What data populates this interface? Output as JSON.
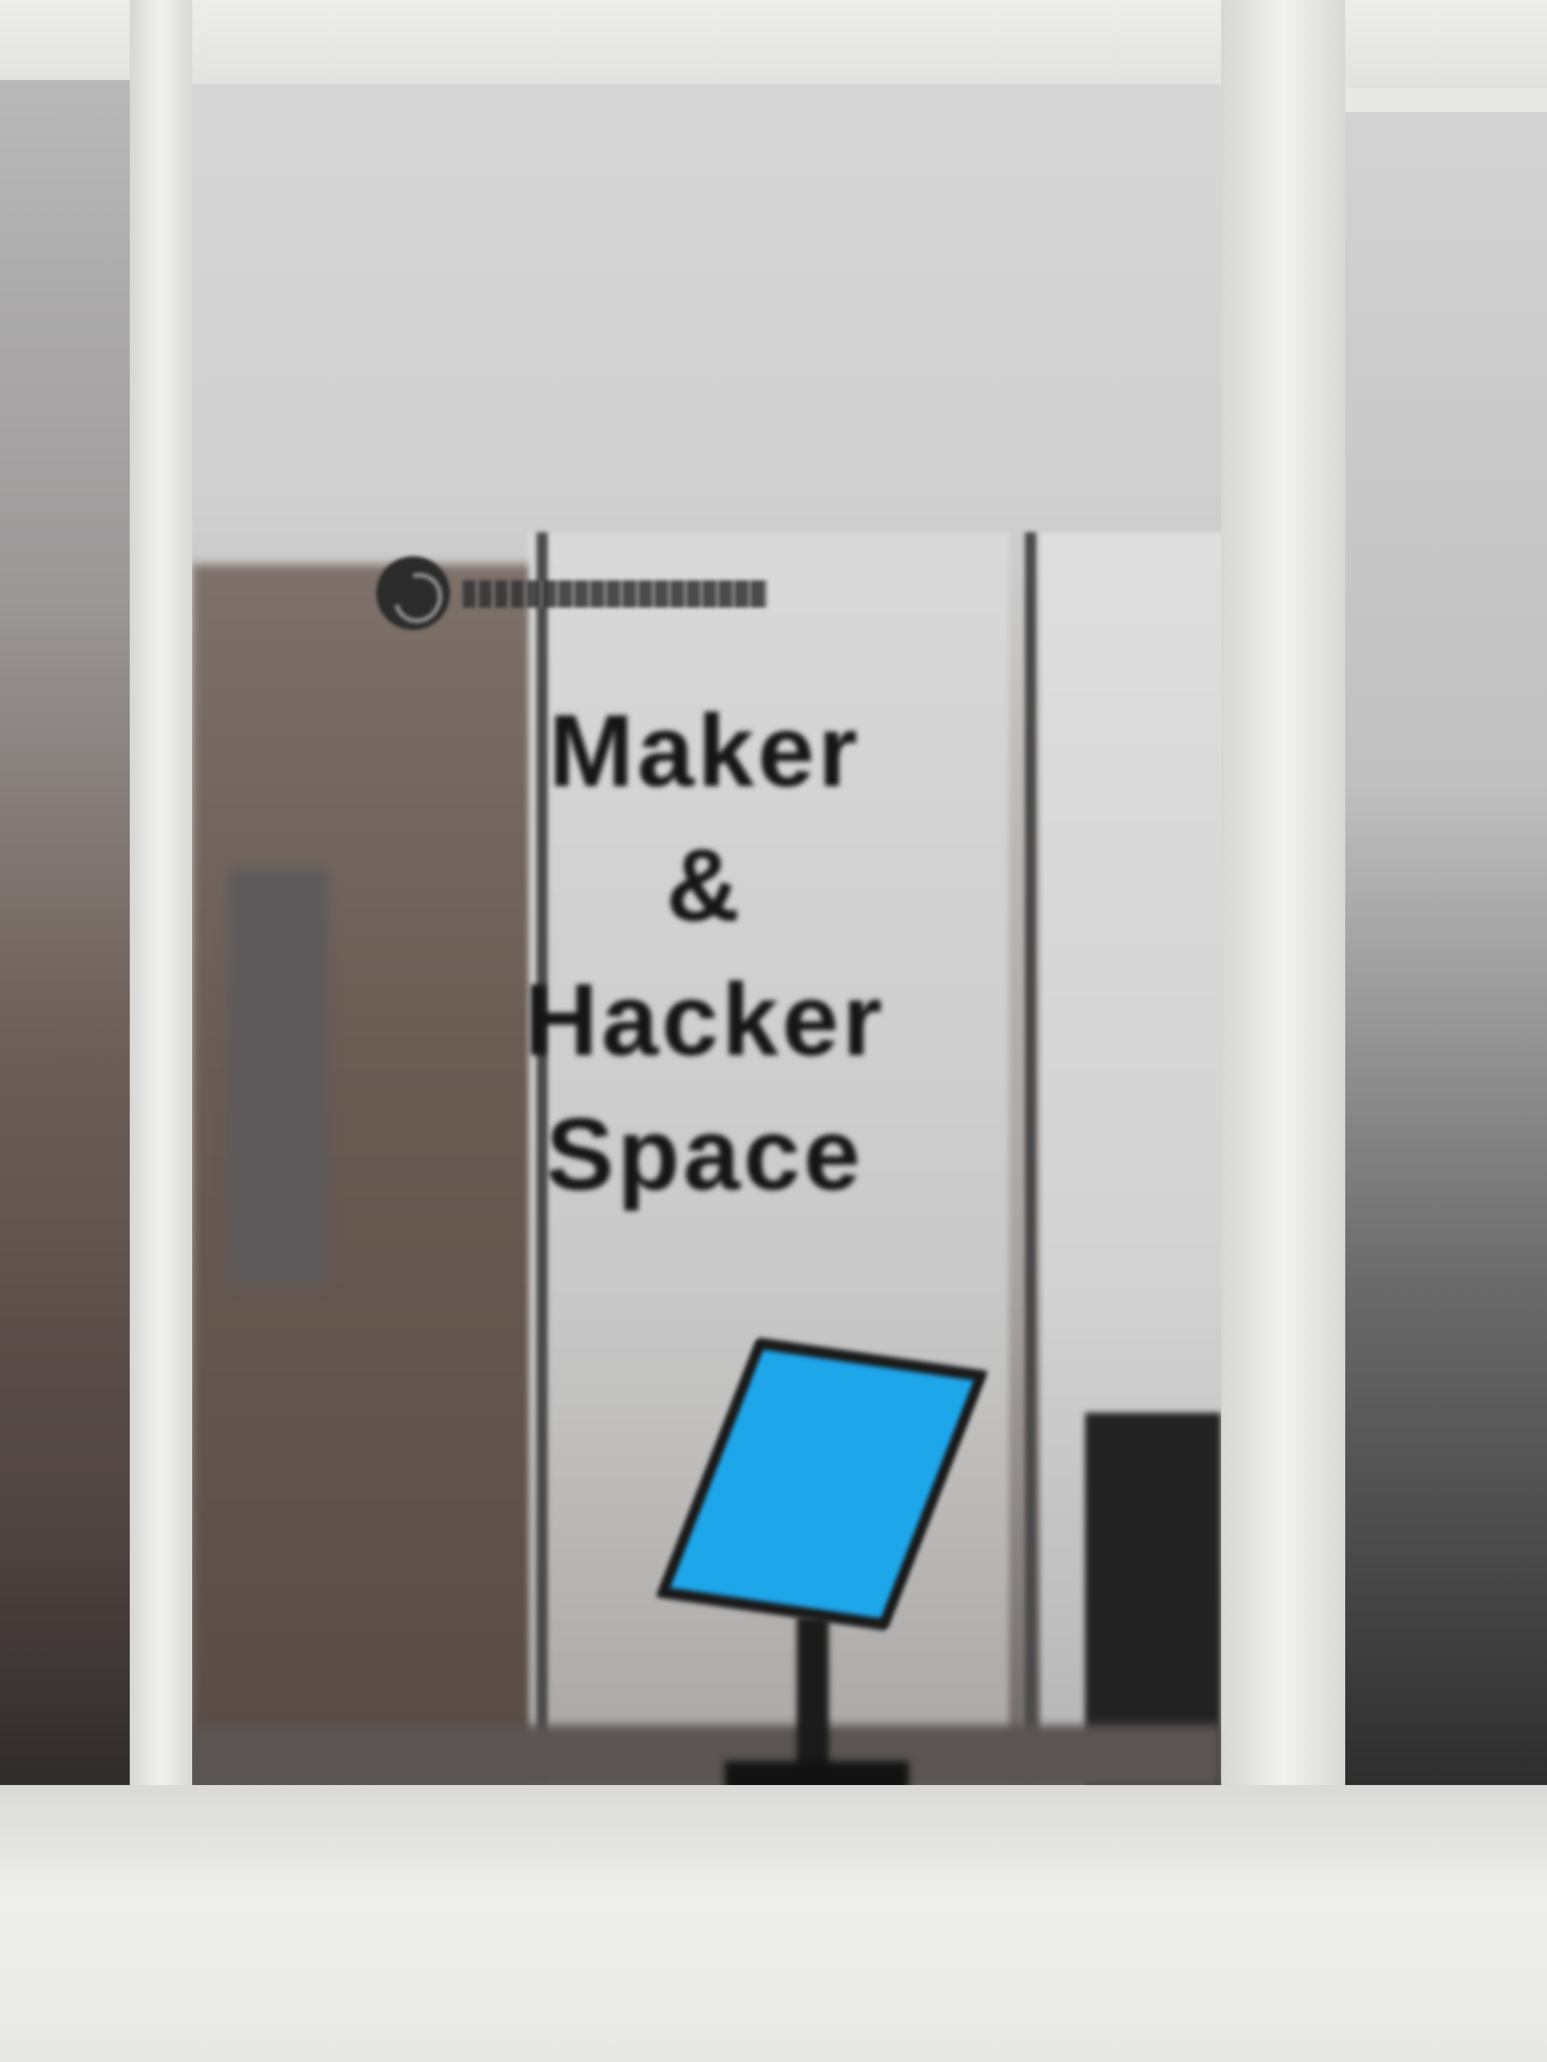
{
  "scene": {
    "sign_lines": [
      "Maker",
      "&",
      "Hacker",
      "Space"
    ],
    "screen_color": "#1ea6ea",
    "icons": [
      "logo-icon"
    ]
  }
}
